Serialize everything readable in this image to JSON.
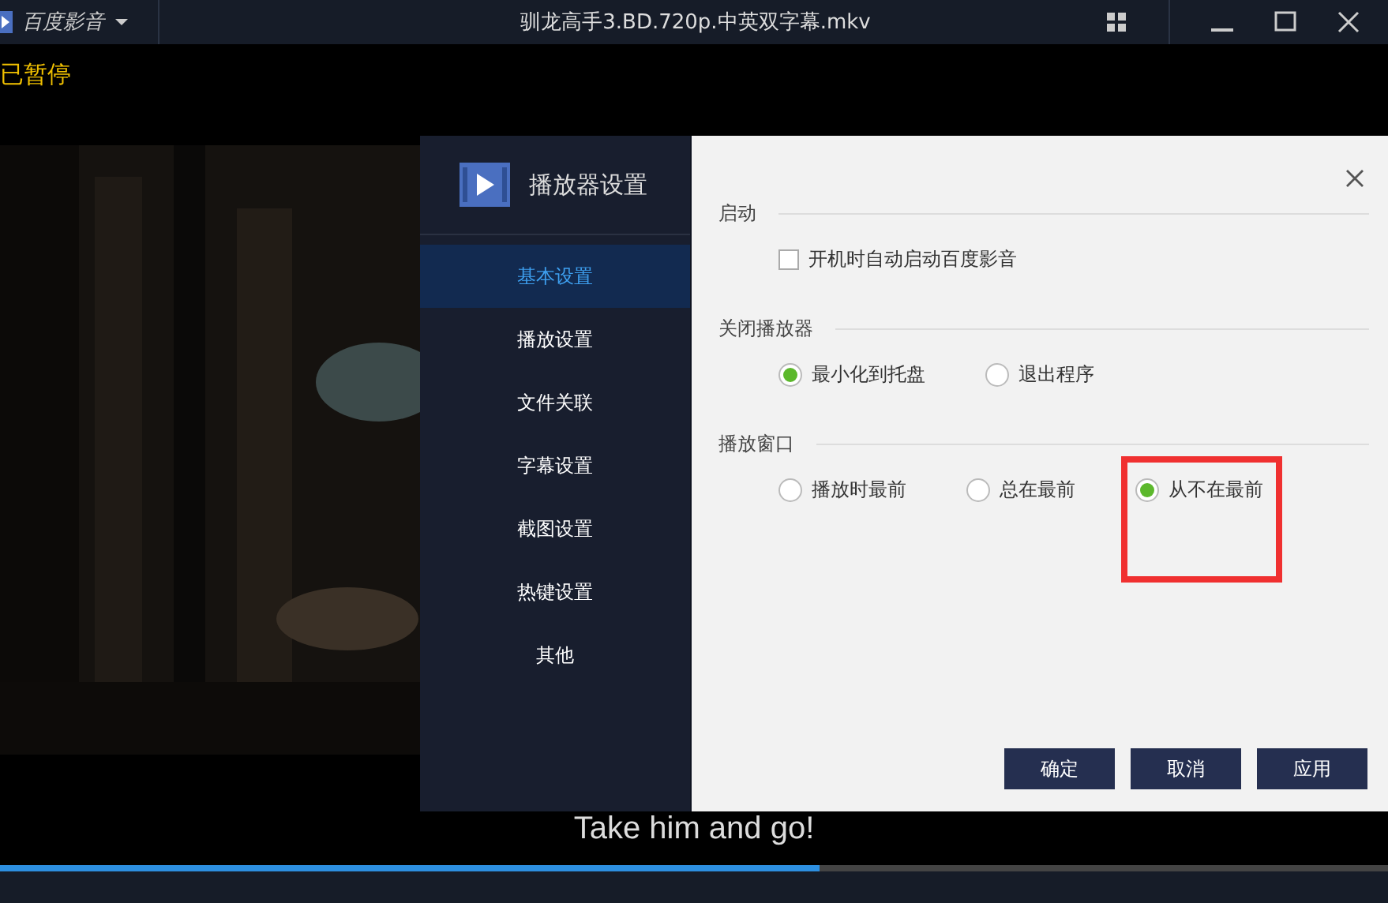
{
  "app": {
    "name": "百度影音"
  },
  "window": {
    "title": "驯龙高手3.BD.720p.中英双字幕.mkv"
  },
  "status": "已暂停",
  "dialog": {
    "title": "播放器设置",
    "nav": [
      {
        "label": "基本设置",
        "selected": true
      },
      {
        "label": "播放设置",
        "selected": false
      },
      {
        "label": "文件关联",
        "selected": false
      },
      {
        "label": "字幕设置",
        "selected": false
      },
      {
        "label": "截图设置",
        "selected": false
      },
      {
        "label": "热键设置",
        "selected": false
      },
      {
        "label": "其他",
        "selected": false
      }
    ],
    "sections": [
      {
        "title": "启动",
        "kind": "checkbox",
        "options": [
          {
            "label": "开机时自动启动百度影音",
            "checked": false
          }
        ]
      },
      {
        "title": "关闭播放器",
        "kind": "radio",
        "options": [
          {
            "label": "最小化到托盘",
            "selected": true
          },
          {
            "label": "退出程序",
            "selected": false
          }
        ]
      },
      {
        "title": "播放窗口",
        "kind": "radio",
        "options": [
          {
            "label": "播放时最前",
            "selected": false
          },
          {
            "label": "总在最前",
            "selected": false
          },
          {
            "label": "从不在最前",
            "selected": true
          }
        ]
      }
    ],
    "buttons": [
      "确定",
      "取消",
      "应用"
    ]
  },
  "subtitle": "Take him and go!",
  "progress": {
    "level": 0.59
  }
}
